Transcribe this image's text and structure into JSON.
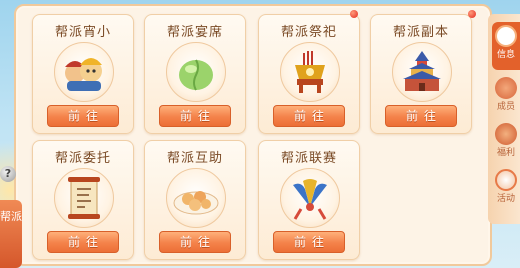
{
  "cards": [
    {
      "title": "帮派宵小",
      "button": "前往",
      "icon": "bandits-group-icon"
    },
    {
      "title": "帮派宴席",
      "button": "前往",
      "icon": "green-dumpling-icon"
    },
    {
      "title": "帮派祭祀",
      "button": "前往",
      "icon": "incense-altar-icon"
    },
    {
      "title": "帮派副本",
      "button": "前往",
      "icon": "pagoda-castle-icon"
    },
    {
      "title": "帮派委托",
      "button": "前往",
      "icon": "scroll-order-icon"
    },
    {
      "title": "帮派互助",
      "button": "前往",
      "icon": "pastry-plate-icon"
    },
    {
      "title": "帮派联赛",
      "button": "前往",
      "icon": "fans-banner-icon"
    }
  ],
  "sidebar": {
    "tabs": [
      {
        "label": "信息",
        "icon": "info-book-icon",
        "active": true
      },
      {
        "label": "成员",
        "icon": "members-icon",
        "active": false
      },
      {
        "label": "福利",
        "icon": "welfare-icon",
        "active": false
      },
      {
        "label": "活动",
        "icon": "activity-icon",
        "active": false
      }
    ]
  },
  "left": {
    "help": "?",
    "guild_tab": "帮派"
  },
  "colors": {
    "accent": "#e3612b",
    "button": "#f4824a",
    "panel": "#fdf3e6",
    "notification": "#e3281e"
  }
}
